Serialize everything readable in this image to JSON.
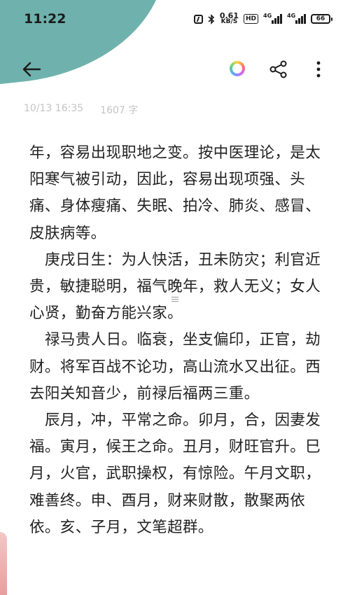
{
  "status_bar": {
    "time": "11:22",
    "net_speed_value": "0.61",
    "net_speed_unit": "KB/S",
    "hd_label": "HD",
    "sig1_label": "4G",
    "sig2_label": "4G",
    "battery": "66"
  },
  "note": {
    "date": "10/13 16:35",
    "word_count": "1607 字",
    "paragraphs": [
      {
        "text": "年，容易出现职地之变。按中医理论，是太阳寒气被引动，因此，容易出现项强、头痛、身体瘦痛、失眠、拍冷、肺炎、感冒、皮肤病等。",
        "indent": false
      },
      {
        "text": "庚戌日生：为人快活，丑未防灾；利官近贵，敏捷聪明，福气晚年，救人无义；女人心贤，勤奋方能兴家。",
        "indent": true
      },
      {
        "text": "禄马贵人日。临衰，坐支偏印，正官，劫财。将军百战不论功，高山流水又出征。西去阳关知音少，前禄后福两三重。",
        "indent": true
      },
      {
        "text": "辰月，冲，平常之命。卯月，合，因妻发福。寅月，候王之命。丑月，财旺官升。巳月，火官，武职操权，有惊险。午月文职，难善终。申、酉月，财来财散，散聚两依依。亥、子月，文笔超群。",
        "indent": true
      }
    ]
  },
  "colors": {
    "accent_blob": "#6fb2ad",
    "text": "#222222",
    "meta_text": "#c4c4c4"
  },
  "icons": {
    "back": "arrow-left-icon",
    "theme": "color-palette-icon",
    "share": "share-icon",
    "more": "more-vertical-icon"
  }
}
